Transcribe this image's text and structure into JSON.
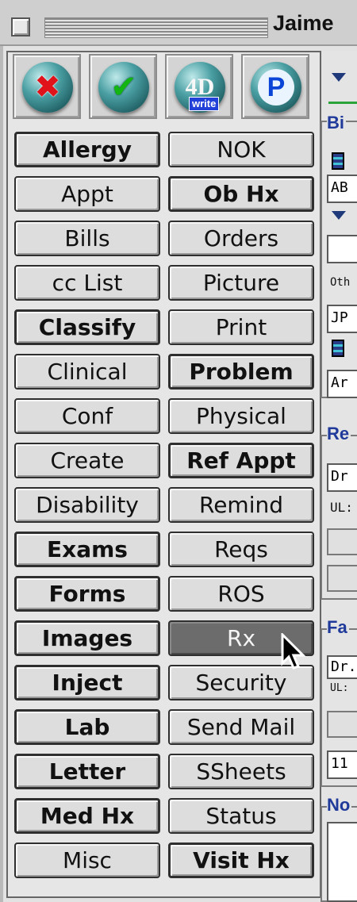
{
  "window": {
    "title": "Jaime"
  },
  "toolbar": {
    "buttons": [
      {
        "name": "cancel",
        "icon": "red-x-icon"
      },
      {
        "name": "ok",
        "icon": "green-check-icon"
      },
      {
        "name": "4d-write",
        "icon": "4d-write-icon",
        "glyph": "4D",
        "badge": "write"
      },
      {
        "name": "p",
        "icon": "p-arrow-icon",
        "glyph": "P"
      }
    ]
  },
  "grid": {
    "left": [
      {
        "label": "Allergy",
        "bold": true
      },
      {
        "label": "Appt",
        "bold": false
      },
      {
        "label": "Bills",
        "bold": false
      },
      {
        "label": "cc List",
        "bold": false
      },
      {
        "label": "Classify",
        "bold": true
      },
      {
        "label": "Clinical",
        "bold": false
      },
      {
        "label": "Conf",
        "bold": false
      },
      {
        "label": "Create",
        "bold": false
      },
      {
        "label": "Disability",
        "bold": false
      },
      {
        "label": "Exams",
        "bold": true
      },
      {
        "label": "Forms",
        "bold": true
      },
      {
        "label": "Images",
        "bold": true
      },
      {
        "label": "Inject",
        "bold": true
      },
      {
        "label": "Lab",
        "bold": true
      },
      {
        "label": "Letter",
        "bold": true
      },
      {
        "label": "Med Hx",
        "bold": true
      },
      {
        "label": "Misc",
        "bold": false
      }
    ],
    "right": [
      {
        "label": "NOK",
        "bold": false
      },
      {
        "label": "Ob Hx",
        "bold": true
      },
      {
        "label": "Orders",
        "bold": false
      },
      {
        "label": "Picture",
        "bold": false
      },
      {
        "label": "Print",
        "bold": false
      },
      {
        "label": "Problem",
        "bold": true
      },
      {
        "label": "Physical",
        "bold": false
      },
      {
        "label": "Ref Appt",
        "bold": true
      },
      {
        "label": "Remind",
        "bold": false
      },
      {
        "label": "Reqs",
        "bold": false
      },
      {
        "label": "ROS",
        "bold": false
      },
      {
        "label": "Rx",
        "bold": false,
        "selected": true
      },
      {
        "label": "Security",
        "bold": false
      },
      {
        "label": "Send Mail",
        "bold": false
      },
      {
        "label": "SSheets",
        "bold": false
      },
      {
        "label": "Status",
        "bold": false
      },
      {
        "label": "Visit Hx",
        "bold": true
      }
    ]
  },
  "right_panel": {
    "group1": {
      "title": "Bi",
      "field1": "AB",
      "other_label": "Oth",
      "field3": "JP",
      "field4": "Ar"
    },
    "group2": {
      "title": "Re",
      "field1": "Dr",
      "sub": "UL:"
    },
    "group3": {
      "title": "Fa",
      "field1": "Dr.",
      "sub": "UL:",
      "field2": "11"
    },
    "group4": {
      "title": "No"
    }
  },
  "colors": {
    "accent_blue": "#1f3a9a",
    "selected_bg": "#6c6c6c",
    "green_rule": "#2ba23a"
  }
}
